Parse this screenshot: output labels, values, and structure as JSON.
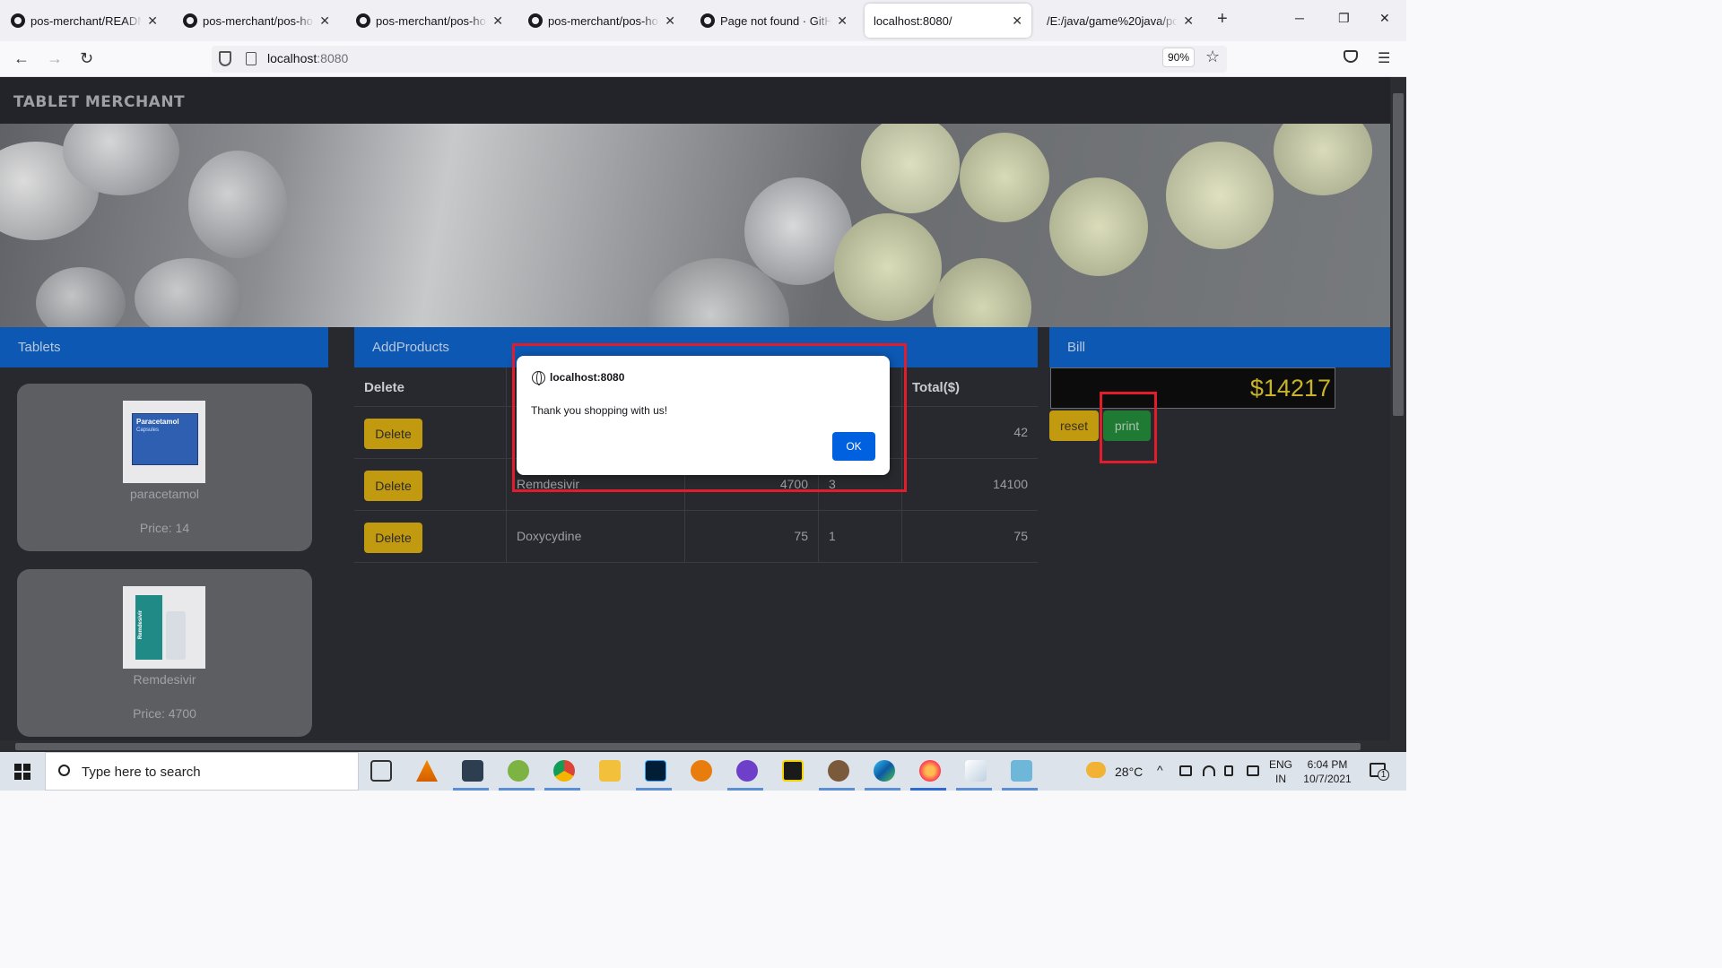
{
  "browser": {
    "tabs": [
      {
        "label": "pos-merchant/README.r",
        "active": false
      },
      {
        "label": "pos-merchant/pos-home",
        "active": false
      },
      {
        "label": "pos-merchant/pos-home",
        "active": false
      },
      {
        "label": "pos-merchant/pos-home",
        "active": false
      },
      {
        "label": "Page not found · GitHub",
        "active": false
      },
      {
        "label": "localhost:8080/",
        "active": true
      },
      {
        "label": "/E:/java/game%20java/pos-r",
        "active": false
      }
    ],
    "url_host": "localhost",
    "url_port": ":8080",
    "zoom": "90%"
  },
  "app": {
    "brand": "TABLET MERCHANT",
    "panels": {
      "tablets": "Tablets",
      "add_products": "AddProducts",
      "bill": "Bill"
    },
    "products": [
      {
        "name": "paracetamol",
        "price_text": "Price: 14",
        "box_label": "Paracetamol",
        "box_sub": "Capsules"
      },
      {
        "name": "Remdesivir",
        "price_text": "Price: 4700",
        "box_label": "Remdesivir"
      }
    ],
    "table": {
      "headers": {
        "delete": "Delete",
        "total": "Total($)"
      },
      "rows": [
        {
          "button": "Delete",
          "name": "",
          "price": "",
          "qty": "",
          "total": "42"
        },
        {
          "button": "Delete",
          "name": "Remdesivir",
          "price": "4700",
          "qty": "3",
          "total": "14100"
        },
        {
          "button": "Delete",
          "name": "Doxycydine",
          "price": "75",
          "qty": "1",
          "total": "75"
        }
      ]
    },
    "bill_total": "$14217",
    "reset_label": "reset",
    "print_label": "print"
  },
  "dialog": {
    "origin": "localhost:8080",
    "message": "Thank you shopping with us!",
    "ok_label": "OK"
  },
  "taskbar": {
    "search_placeholder": "Type here to search",
    "temperature": "28°C",
    "lang_1": "ENG",
    "lang_2": "IN",
    "time": "6:04 PM",
    "date": "10/7/2021",
    "notifications": "1"
  }
}
